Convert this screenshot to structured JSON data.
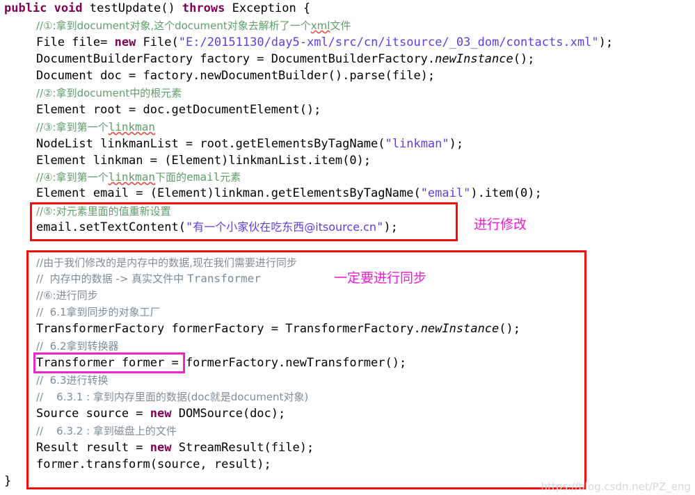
{
  "editor": {
    "language": "java",
    "colors": {
      "keyword": "#7f0055",
      "string": "#5b3ee8",
      "comment_green": "#5f9e68",
      "comment_gray": "#7f8d97",
      "plain_text": "#000000",
      "annotation_magenta": "#f518d8",
      "box_red": "#fb0b0b",
      "box_magenta": "#ef24cf",
      "background": "#ffffff"
    },
    "code_lines": [
      {
        "n": 1,
        "indent": 0,
        "text": "public void testUpdate() throws Exception {"
      },
      {
        "n": 2,
        "indent": 1,
        "text": "//①:拿到document对象,这个document对象去解析了一个xml文件"
      },
      {
        "n": 3,
        "indent": 1,
        "text": "File file= new File(\"E:/20151130/day5-xml/src/cn/itsource/_03_dom/contacts.xml\");"
      },
      {
        "n": 4,
        "indent": 1,
        "text": "DocumentBuilderFactory factory = DocumentBuilderFactory.newInstance();"
      },
      {
        "n": 5,
        "indent": 1,
        "text": "Document doc = factory.newDocumentBuilder().parse(file);"
      },
      {
        "n": 6,
        "indent": 1,
        "text": "//②:拿到document中的根元素"
      },
      {
        "n": 7,
        "indent": 1,
        "text": "Element root = doc.getDocumentElement();"
      },
      {
        "n": 8,
        "indent": 1,
        "text": "//③:拿到第一个linkman"
      },
      {
        "n": 9,
        "indent": 1,
        "text": "NodeList linkmanList = root.getElementsByTagName(\"linkman\");"
      },
      {
        "n": 10,
        "indent": 1,
        "text": "Element linkman = (Element)linkmanList.item(0);"
      },
      {
        "n": 11,
        "indent": 1,
        "text": "//④:拿到第一个linkman下面的email元素"
      },
      {
        "n": 12,
        "indent": 1,
        "text": "Element email = (Element)linkman.getElementsByTagName(\"email\").item(0);"
      },
      {
        "n": 13,
        "indent": 1,
        "text": "//⑤:对元素里面的值重新设置"
      },
      {
        "n": 14,
        "indent": 1,
        "text": "email.setTextContent(\"有一个小家伙在吃东西@itsource.cn\");"
      },
      {
        "n": 15,
        "indent": 1,
        "text": "//由于我们修改的是内存中的数据,现在我们需要进行同步"
      },
      {
        "n": 16,
        "indent": 1,
        "text": "//  内存中的数据 -> 真实文件中 Transformer"
      },
      {
        "n": 17,
        "indent": 1,
        "text": "//⑥:进行同步"
      },
      {
        "n": 18,
        "indent": 1,
        "text": "//  6.1拿到同步的对象工厂"
      },
      {
        "n": 19,
        "indent": 1,
        "text": "TransformerFactory formerFactory = TransformerFactory.newInstance();"
      },
      {
        "n": 20,
        "indent": 1,
        "text": "//  6.2拿到转换器"
      },
      {
        "n": 21,
        "indent": 1,
        "text": "Transformer former = formerFactory.newTransformer();"
      },
      {
        "n": 22,
        "indent": 1,
        "text": "//  6.3进行转换"
      },
      {
        "n": 23,
        "indent": 1,
        "text": "//    6.3.1 : 拿到内存里面的数据(doc就是document对象)"
      },
      {
        "n": 24,
        "indent": 1,
        "text": "Source source = new DOMSource(doc);"
      },
      {
        "n": 25,
        "indent": 1,
        "text": "//    6.3.2 : 拿到磁盘上的文件"
      },
      {
        "n": 26,
        "indent": 1,
        "text": "Result result = new StreamResult(file);"
      },
      {
        "n": 27,
        "indent": 1,
        "text": "former.transform(source, result);"
      },
      {
        "n": 28,
        "indent": 0,
        "text": "}"
      }
    ],
    "tokens": {
      "l1": {
        "kw_public": "public",
        "kw_void": "void",
        "method": " testUpdate() ",
        "kw_throws": "throws",
        "tail": " Exception {"
      },
      "l3": {
        "pre": "File file= ",
        "kw_new": "new",
        "mid": " File(",
        "q1": "\"",
        "path": "E:/20151130/day5-xml/src/cn/itsource/_03_dom/contacts.xml",
        "q2": "\"",
        "tail": ");"
      },
      "l4": {
        "pre": "DocumentBuilderFactory factory = DocumentBuilderFactory.",
        "ital": "newInstance",
        "tail": "();"
      },
      "l5": {
        "all": "Document doc = factory.newDocumentBuilder().parse(file);"
      },
      "l7": {
        "all": "Element root = doc.getDocumentElement();"
      },
      "l9": {
        "pre": "NodeList linkmanList = root.getElementsByTagName(",
        "str": "\"linkman\"",
        "tail": ");"
      },
      "l10": {
        "all": "Element linkman = (Element)linkmanList.item(0);"
      },
      "l12": {
        "pre": "Element email = (Element)linkman.getElementsByTagName(",
        "str": "\"email\"",
        "tail": ").item(0);"
      },
      "l14": {
        "pre": "email.setTextContent(",
        "q1": "\"",
        "str_cn": "有一个小家伙在吃东西@itsource.cn",
        "q2": "\"",
        "tail": ");"
      },
      "l19": {
        "pre": "TransformerFactory formerFactory = TransformerFactory.",
        "ital": "newInstance",
        "tail": "();"
      },
      "l21": {
        "boxed": "Transformer former",
        "tail": " = formerFactory.newTransformer();"
      },
      "l24": {
        "pre": "Source source = ",
        "kw_new": "new",
        "tail": " DOMSource(doc);"
      },
      "l26": {
        "pre": "Result result = ",
        "kw_new": "new",
        "tail": " StreamResult(file);"
      },
      "l27": {
        "all": "former.transform(source, result);"
      },
      "l28": {
        "all": "}"
      }
    },
    "comments": {
      "c2_head": "//①:",
      "c2_body_a": "拿到",
      "c2_doc1": "document",
      "c2_body_b": "对象,这个",
      "c2_doc2": "document",
      "c2_body_c": "对象去解析了一个",
      "c2_xml": "xml",
      "c2_body_d": "文件",
      "c6": "//②:拿到document中的根元素",
      "c6_head": "//②:拿到document中的根元素",
      "c8_head": "//③:拿到第一个",
      "c8_link": "linkman",
      "c11_head": "//④:拿到第一个",
      "c11_link": "linkman",
      "c11_mid": "下面的",
      "c11_email": "email",
      "c11_tail": "元素",
      "c13": "//⑤:对元素里面的值重新设置",
      "c15": "//由于我们修改的是内存中的数据,现在我们需要进行同步",
      "c16_head": "//  内存中的数据 -> 真实文件中 ",
      "c16_transformer": "Transformer",
      "c17": "//⑥:进行同步",
      "c18": "//  6.1拿到同步的对象工厂",
      "c20": "//  6.2拿到转换器",
      "c22": "//  6.3进行转换",
      "c23": "//    6.3.1 : 拿到内存里面的数据(doc就是document对象)",
      "c25": "//    6.3.2 : 拿到磁盘上的文件"
    },
    "annotations": [
      {
        "id": "annot-modify",
        "label": "进行修改",
        "color": "#f518d8"
      },
      {
        "id": "annot-sync",
        "label": "一定要进行同步",
        "color": "#f518d8"
      }
    ],
    "highlight_boxes": [
      {
        "id": "box-set-text-content",
        "color": "#fb0b0b",
        "covers": "lines 13-14"
      },
      {
        "id": "box-sync-block",
        "color": "#fb0b0b",
        "covers": "lines 15-27"
      },
      {
        "id": "box-transformer-former",
        "color": "#ef24cf",
        "covers": "line 21 declaration"
      }
    ]
  },
  "watermark": {
    "text": "https://blog.csdn.net/PZ_eng"
  }
}
